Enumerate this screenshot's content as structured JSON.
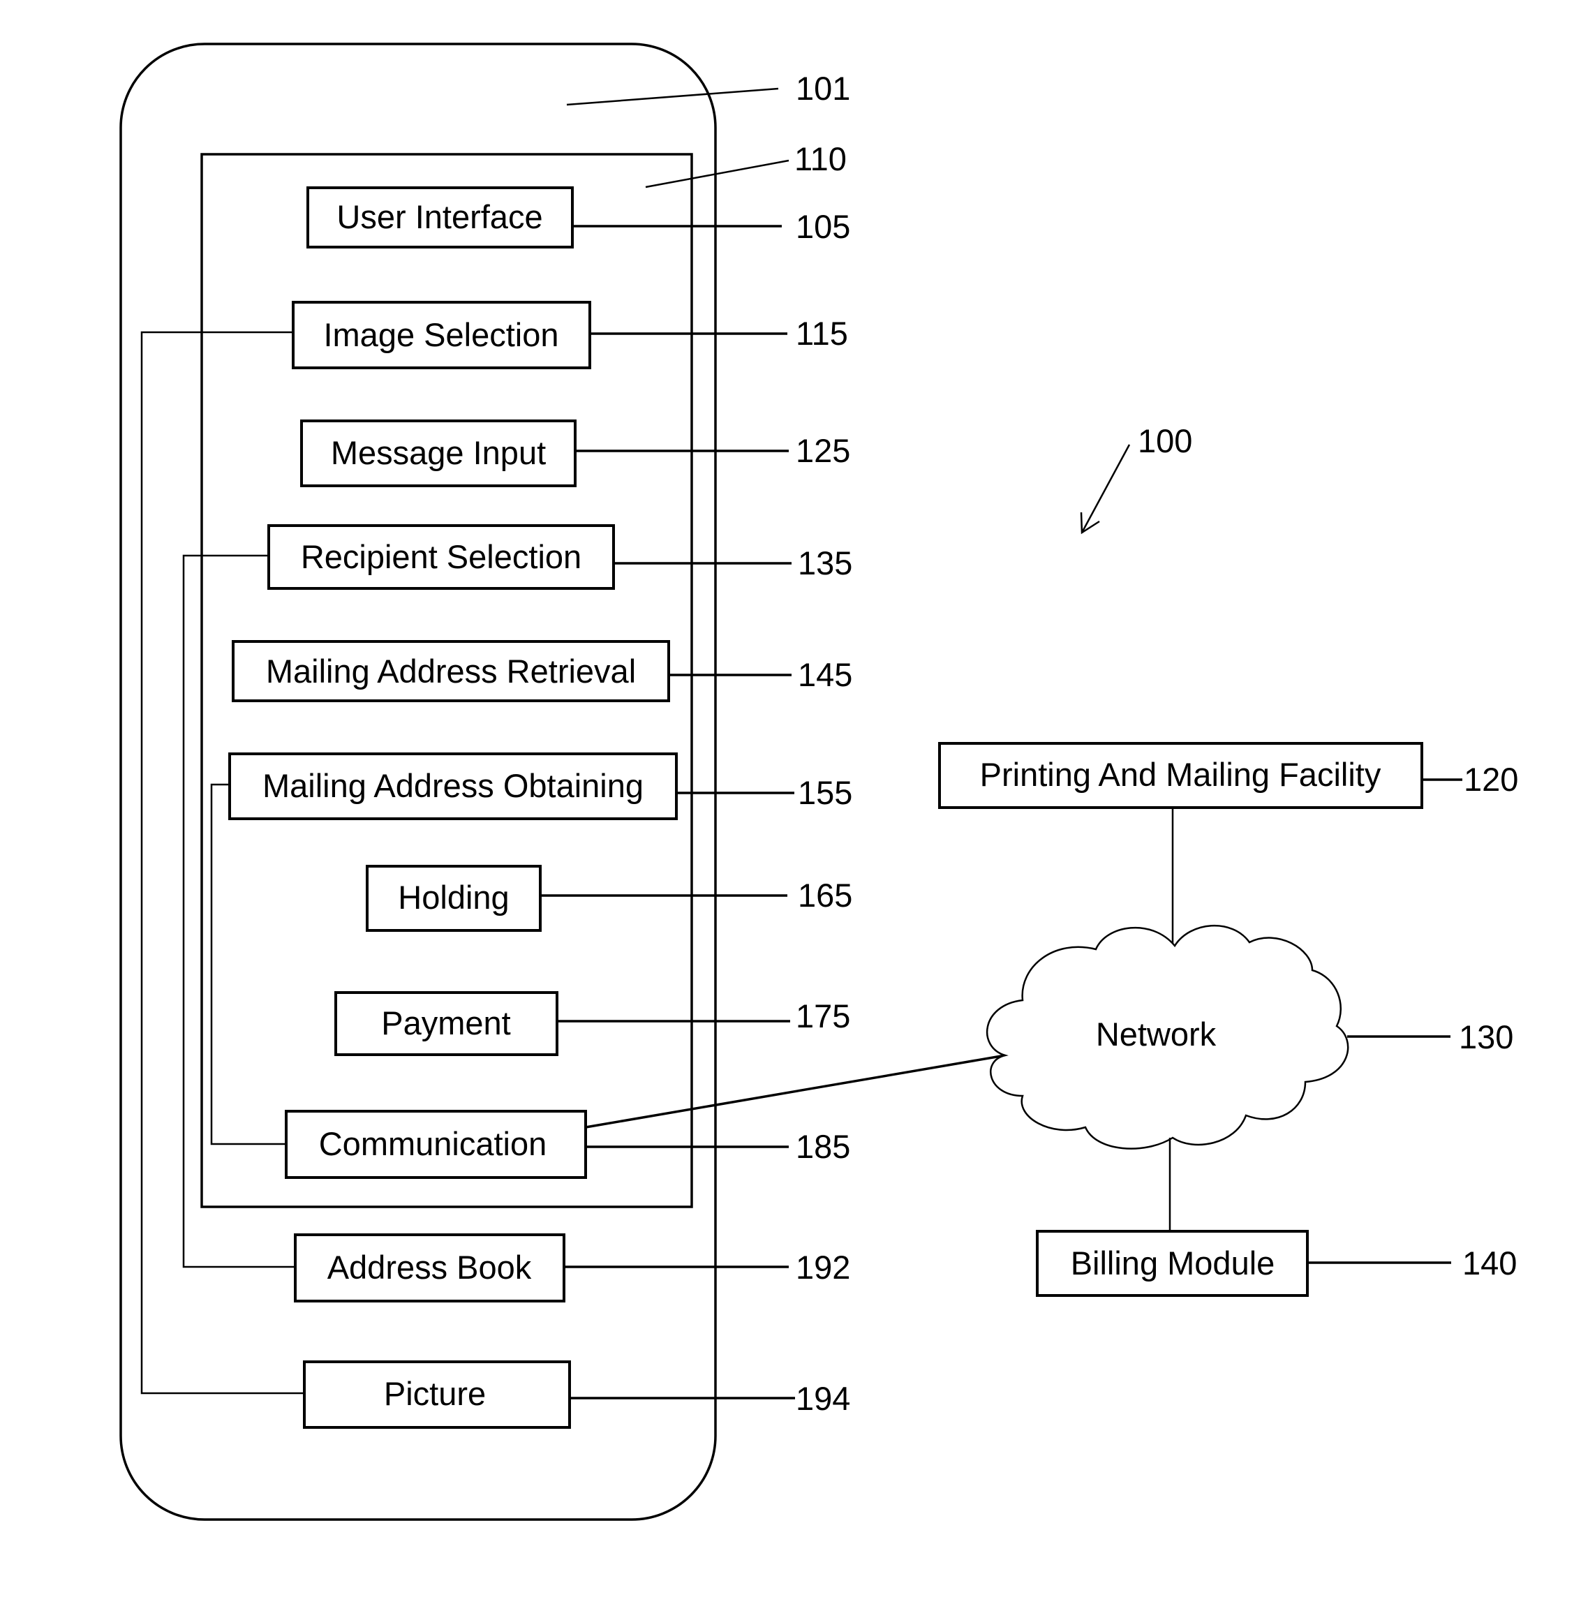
{
  "figure": {
    "system_ref": "100",
    "device_ref": "101",
    "application_ref": "110"
  },
  "modules": [
    {
      "id": "user_interface",
      "label": "User Interface",
      "ref": "105"
    },
    {
      "id": "image_selection",
      "label": "Image Selection",
      "ref": "115"
    },
    {
      "id": "message_input",
      "label": "Message Input",
      "ref": "125"
    },
    {
      "id": "recipient_selection",
      "label": "Recipient Selection",
      "ref": "135"
    },
    {
      "id": "mailing_address_retrieval",
      "label": "Mailing Address Retrieval",
      "ref": "145"
    },
    {
      "id": "mailing_address_obtaining",
      "label": "Mailing Address Obtaining",
      "ref": "155"
    },
    {
      "id": "holding",
      "label": "Holding",
      "ref": "165"
    },
    {
      "id": "payment",
      "label": "Payment",
      "ref": "175"
    },
    {
      "id": "communication",
      "label": "Communication",
      "ref": "185"
    }
  ],
  "device_data": [
    {
      "id": "address_book",
      "label": "Address Book",
      "ref": "192"
    },
    {
      "id": "picture",
      "label": "Picture",
      "ref": "194"
    }
  ],
  "external": {
    "printing_facility": {
      "label": "Printing And Mailing Facility",
      "ref": "120"
    },
    "network": {
      "label": "Network",
      "ref": "130"
    },
    "billing": {
      "label": "Billing Module",
      "ref": "140"
    }
  }
}
